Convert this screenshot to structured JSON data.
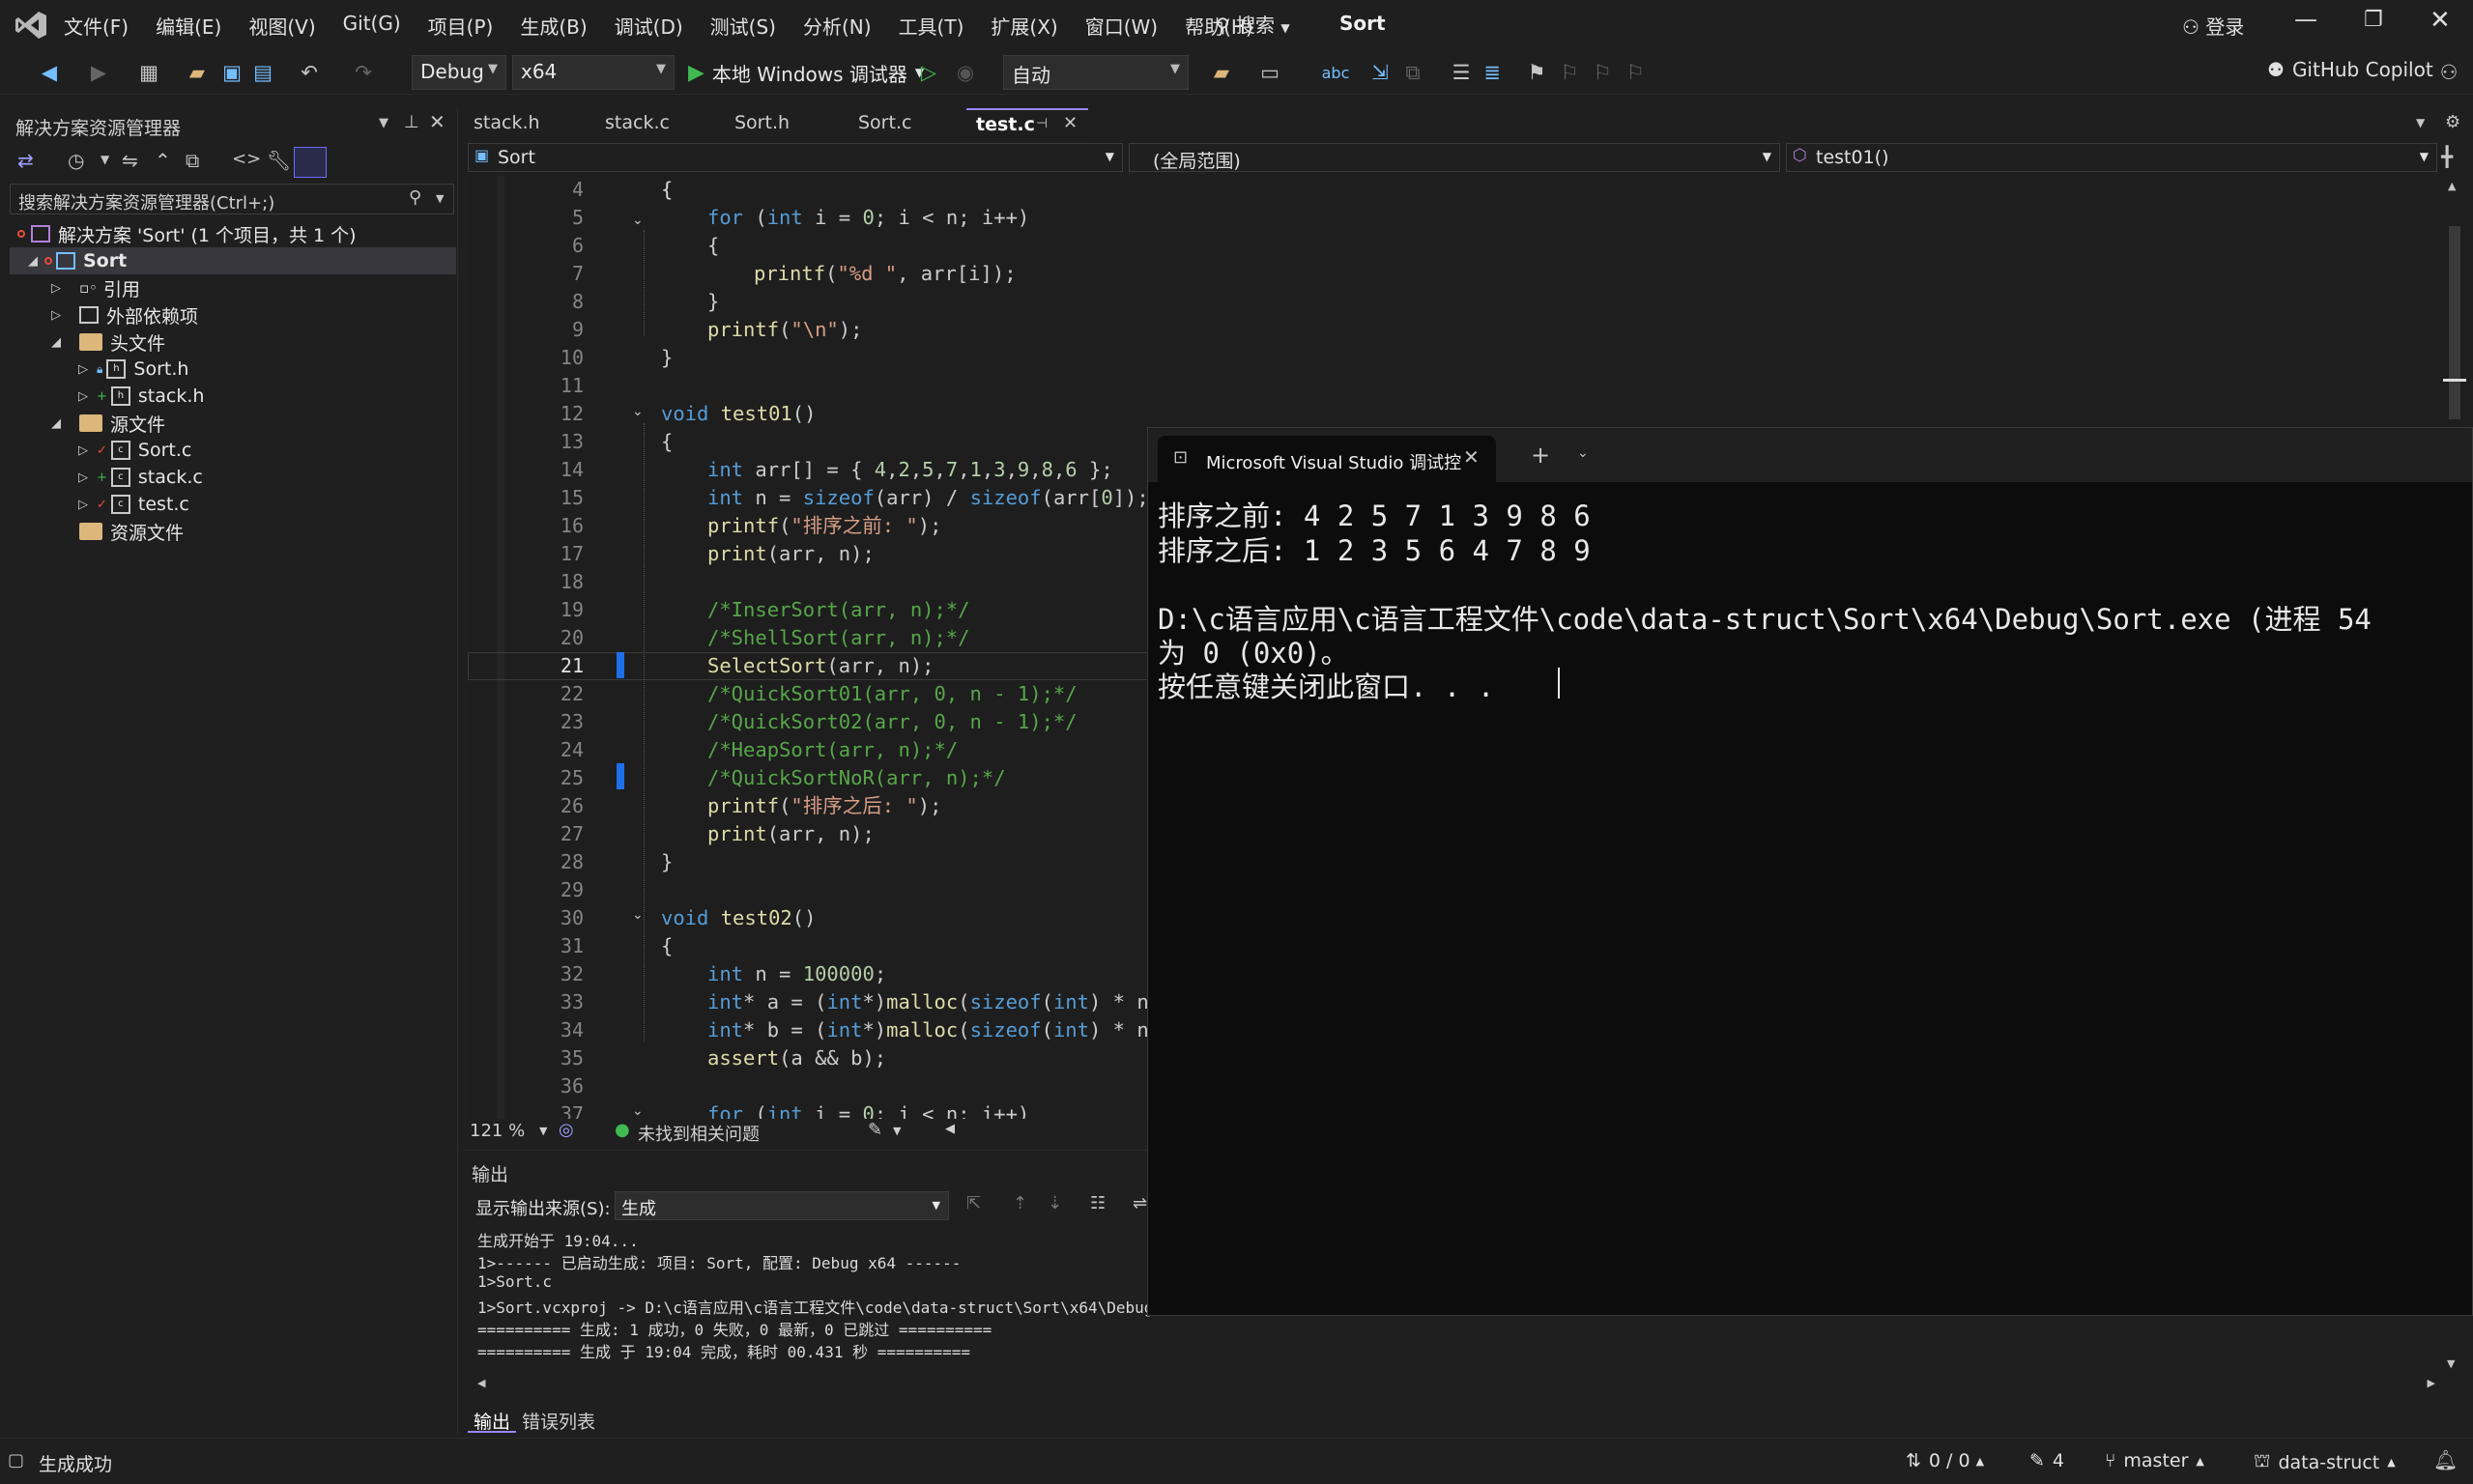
{
  "menubar": {
    "items": [
      "文件(F)",
      "编辑(E)",
      "视图(V)",
      "Git(G)",
      "项目(P)",
      "生成(B)",
      "调试(D)",
      "测试(S)",
      "分析(N)",
      "工具(T)",
      "扩展(X)",
      "窗口(W)",
      "帮助(H)"
    ],
    "search": "搜索",
    "solution_name": "Sort",
    "login": "登录"
  },
  "toolbar": {
    "config": "Debug",
    "platform": "x64",
    "run_label": "本地 Windows 调试器",
    "auto_combo": "自动",
    "copilot": "GitHub Copilot"
  },
  "solution_explorer": {
    "title": "解决方案资源管理器",
    "search_placeholder": "搜索解决方案资源管理器(Ctrl+;)",
    "solution_label": "解决方案 'Sort' (1 个项目，共 1 个)",
    "project": "Sort",
    "ref": "引用",
    "external": "外部依赖项",
    "headers": "头文件",
    "sort_h": "Sort.h",
    "stack_h": "stack.h",
    "sources": "源文件",
    "sort_c": "Sort.c",
    "stack_c": "stack.c",
    "test_c": "test.c",
    "resources": "资源文件"
  },
  "tabs": [
    "stack.h",
    "stack.c",
    "Sort.h",
    "Sort.c",
    "test.c"
  ],
  "nav": {
    "project": "Sort",
    "scope": "(全局范围)",
    "function": "test01()"
  },
  "editor": {
    "zoom": "121 %",
    "issues": "未找到相关问题",
    "line_numbers": [
      "4",
      "5",
      "6",
      "7",
      "8",
      "9",
      "10",
      "11",
      "12",
      "13",
      "14",
      "15",
      "16",
      "17",
      "18",
      "19",
      "20",
      "21",
      "22",
      "23",
      "24",
      "25",
      "26",
      "27",
      "28",
      "29",
      "30",
      "31",
      "32",
      "33",
      "34",
      "35",
      "36",
      "37"
    ],
    "current_line": "21"
  },
  "console": {
    "title": "Microsoft Visual Studio 调试控",
    "lines": [
      "排序之前: 4 2 5 7 1 3 9 8 6",
      "排序之后: 1 2 3 5 6 4 7 8 9",
      "",
      "D:\\c语言应用\\c语言工程文件\\code\\data-struct\\Sort\\x64\\Debug\\Sort.exe (进程 54",
      "为 0 (0x0)。",
      "按任意键关闭此窗口. . ."
    ]
  },
  "output": {
    "title": "输出",
    "source_label": "显示输出来源(S):",
    "source_value": "生成",
    "lines": [
      "生成开始于 19:04...",
      "1>------ 已启动生成: 项目: Sort, 配置: Debug x64 ------",
      "1>Sort.c",
      "1>Sort.vcxproj -> D:\\c语言应用\\c语言工程文件\\code\\data-struct\\Sort\\x64\\Debug",
      "========== 生成: 1 成功，0 失败，0 最新，0 已跳过 ==========",
      "========== 生成 于 19:04 完成，耗时 00.431 秒 =========="
    ],
    "tab_output": "输出",
    "tab_errors": "错误列表"
  },
  "status": {
    "build": "生成成功",
    "updown": "0 / 0",
    "pencil": "4",
    "branch": "master",
    "repo": "data-struct"
  }
}
